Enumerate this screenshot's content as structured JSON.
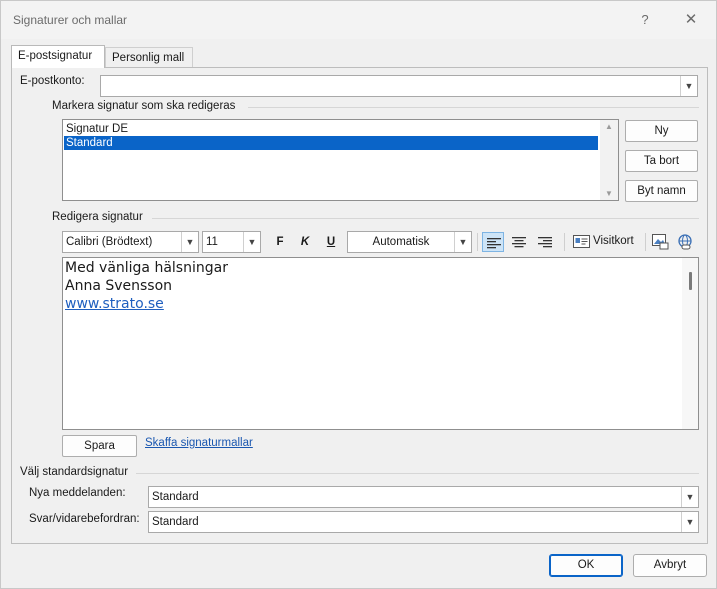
{
  "window": {
    "title": "Signaturer och mallar",
    "help_glyph": "?",
    "close_glyph": "✕"
  },
  "tabs": [
    {
      "label": "E-postsignatur",
      "active": true
    },
    {
      "label": "Personlig mall",
      "active": false
    }
  ],
  "account": {
    "label": "E-postkonto:",
    "value": ""
  },
  "select_section": {
    "title": "Markera signatur som ska redigeras"
  },
  "signatures": [
    {
      "name": "Signatur DE",
      "selected": false
    },
    {
      "name": "Standard",
      "selected": true
    }
  ],
  "side_buttons": {
    "new": "Ny",
    "delete": "Ta bort",
    "rename": "Byt namn"
  },
  "edit_section": {
    "title": "Redigera signatur"
  },
  "toolbar": {
    "font": "Calibri (Brödtext)",
    "size": "11",
    "bold": "F",
    "italic": "K",
    "underline": "U",
    "color": "Automatisk",
    "business_card": "Visitkort"
  },
  "signature_body": {
    "line1": "Med vänliga hälsningar",
    "line2": "Anna Svensson",
    "link": "www.strato.se"
  },
  "save_label": "Spara",
  "templates_link": "Skaffa signaturmallar",
  "defaults": {
    "title": "Välj standardsignatur",
    "new_messages_label": "Nya meddelanden:",
    "new_messages_value": "Standard",
    "reply_label": "Svar/vidarebefordran:",
    "reply_value": "Standard"
  },
  "footer": {
    "ok": "OK",
    "cancel": "Avbryt"
  },
  "colors": {
    "selection": "#0a64c8",
    "link": "#1f5fbf",
    "accent": "#0a64c8"
  }
}
